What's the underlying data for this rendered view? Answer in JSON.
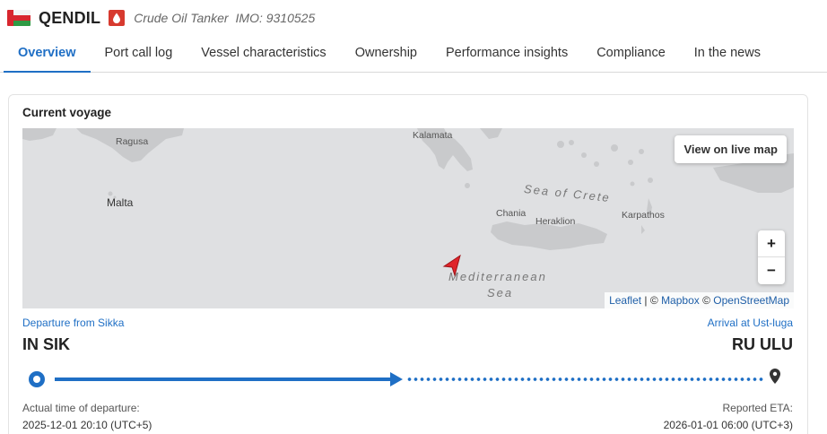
{
  "vessel": {
    "flag_icon": "oman-flag-icon",
    "name": "QENDIL",
    "type_icon": "tanker-icon",
    "type": "Crude Oil Tanker",
    "imo": "IMO: 9310525"
  },
  "tabs": [
    {
      "label": "Overview",
      "active": true
    },
    {
      "label": "Port call log"
    },
    {
      "label": "Vessel characteristics"
    },
    {
      "label": "Ownership"
    },
    {
      "label": "Performance insights"
    },
    {
      "label": "Compliance"
    },
    {
      "label": "In the news"
    }
  ],
  "voyage": {
    "title": "Current voyage",
    "map": {
      "live_map_button": "View on live map",
      "zoom_in": "+",
      "zoom_out": "−",
      "places": {
        "ragusa": "Ragusa",
        "kalamata": "Kalamata",
        "malta": "Malta",
        "chania": "Chania",
        "heraklion": "Heraklion",
        "karpathos": "Karpathos"
      },
      "seas": {
        "crete": "Sea of Crete",
        "med_line1": "Mediterranean",
        "med_line2": "Sea"
      },
      "attribution": {
        "leaflet": "Leaflet",
        "sep": " | © ",
        "mapbox": "Mapbox",
        "copy": " © ",
        "osm": "OpenStreetMap"
      }
    },
    "departure": {
      "label": "Departure from Sikka",
      "code": "IN SIK",
      "time_label": "Actual time of departure:",
      "time": "2025-12-01 20:10 (UTC+5)"
    },
    "arrival": {
      "label": "Arrival at Ust-luga",
      "code": "RU ULU",
      "time_label": "Reported ETA:",
      "time": "2026-01-01 06:00 (UTC+3)"
    }
  },
  "colors": {
    "accent": "#1f6fc5",
    "tanker": "#d73a2f",
    "vessel_marker": "#e0242a"
  }
}
